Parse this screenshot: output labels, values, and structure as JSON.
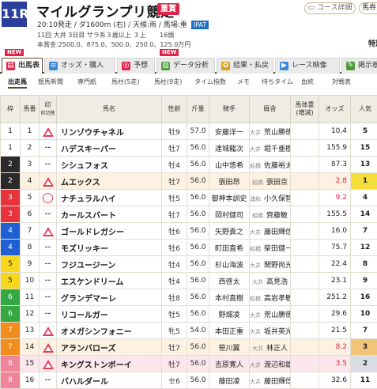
{
  "header": {
    "race_number": "11R",
    "race_name": "マイルグランプリ競走",
    "grade": "重賞",
    "course_btn": "コース詳細",
    "horse_btn": "馬券",
    "detail_line1": "20:10発走 / ダ1600m (右) / 天候:雨",
    "track_cond": "/ 馬場:重",
    "ipat": "IPAT",
    "detail_line2": "11回 大井 3日目 サラ系３歳以上 ３上",
    "head_count": "16頭",
    "prize_line": "本賞金:2500.0、875.0、500.0、250.0、125.0万円",
    "special": "特別"
  },
  "tabs": [
    {
      "label": "出馬表",
      "icon": "table-icon",
      "active": true,
      "is_new": true
    },
    {
      "label": "オッズ・購入",
      "icon": "odds-icon",
      "active": false,
      "is_new": false
    },
    {
      "label": "予想",
      "icon": "target-icon",
      "active": false,
      "is_new": false
    },
    {
      "label": "データ分析",
      "icon": "chart-icon",
      "active": false,
      "is_new": true
    },
    {
      "label": "結果・払戻",
      "icon": "trophy-icon",
      "active": false,
      "is_new": false
    },
    {
      "label": "レース映像",
      "icon": "video-icon",
      "active": false,
      "is_new": false
    },
    {
      "label": "掲示板",
      "icon": "board-icon",
      "active": false,
      "is_new": false
    }
  ],
  "new_badge": "NEW",
  "subtabs": [
    "出走馬",
    "競馬新聞",
    "専門紙",
    "馬柱(5走)",
    "馬柱(9走)",
    "タイム指数",
    "メモ",
    "持ちタイム",
    "血統",
    "対戦表"
  ],
  "table": {
    "headers": {
      "waku": "枠",
      "uma": "馬番",
      "mark": "印",
      "mark_sub": "印切替",
      "name": "馬名",
      "sexage": "性齢",
      "kinryo": "斤量",
      "jockey": "騎手",
      "trainer": "厩舎",
      "weight": "馬体重(増減)",
      "odds": "オッズ",
      "pop": "人気"
    },
    "rows": [
      {
        "waku": "1",
        "uma": "1",
        "mark": "tri",
        "name": "リンゾウチャネル",
        "sexage": "牡9",
        "kinryo": "57.0",
        "jockey": "安藤洋一",
        "loc": "大井",
        "trainer": "荒山勝徳",
        "weight": "",
        "odds": "10.4",
        "pop": "5"
      },
      {
        "waku": "1",
        "uma": "2",
        "mark": "dash",
        "name": "ハデスキーパー",
        "sexage": "牡7",
        "kinryo": "56.0",
        "jockey": "達城龍次",
        "loc": "大井",
        "trainer": "堀千亜樹",
        "weight": "",
        "odds": "155.9",
        "pop": "15"
      },
      {
        "waku": "2",
        "uma": "3",
        "mark": "dash",
        "name": "シシュフォス",
        "sexage": "牡4",
        "kinryo": "56.0",
        "jockey": "山中悠希",
        "loc": "船橋",
        "trainer": "佐藤裕太",
        "weight": "",
        "odds": "87.3",
        "pop": "13"
      },
      {
        "waku": "2",
        "uma": "4",
        "mark": "tri",
        "name": "ムエックス",
        "sexage": "牡7",
        "kinryo": "56.0",
        "jockey": "張田昂",
        "loc": "船橋",
        "trainer": "張田京",
        "weight": "",
        "odds": "2.8",
        "pop": "1"
      },
      {
        "waku": "3",
        "uma": "5",
        "mark": "circle",
        "name": "ナチュラルハイ",
        "sexage": "牡5",
        "kinryo": "56.0",
        "jockey": "御神本訓史",
        "loc": "浦和",
        "trainer": "小久保智",
        "weight": "",
        "odds": "9.2",
        "pop": "4"
      },
      {
        "waku": "3",
        "uma": "6",
        "mark": "dash",
        "name": "カールスバート",
        "sexage": "牡7",
        "kinryo": "56.0",
        "jockey": "岡村健司",
        "loc": "船橋",
        "trainer": "齊藤敏",
        "weight": "",
        "odds": "155.5",
        "pop": "14"
      },
      {
        "waku": "4",
        "uma": "7",
        "mark": "tri",
        "name": "ゴールドレガシー",
        "sexage": "牡6",
        "kinryo": "56.0",
        "jockey": "矢野貴之",
        "loc": "大井",
        "trainer": "藤田輝信",
        "weight": "",
        "odds": "16.0",
        "pop": "7"
      },
      {
        "waku": "4",
        "uma": "8",
        "mark": "dash",
        "name": "モズリッキー",
        "sexage": "牡6",
        "kinryo": "56.0",
        "jockey": "町田直希",
        "loc": "船橋",
        "trainer": "柴田健一",
        "weight": "",
        "odds": "75.7",
        "pop": "12"
      },
      {
        "waku": "5",
        "uma": "9",
        "mark": "dash",
        "name": "フジユージーン",
        "sexage": "牡4",
        "kinryo": "56.0",
        "jockey": "杉山海波",
        "loc": "大井",
        "trainer": "関野尚光",
        "weight": "",
        "odds": "22.4",
        "pop": "8"
      },
      {
        "waku": "5",
        "uma": "10",
        "mark": "dash",
        "name": "エスケンドリーム",
        "sexage": "牡4",
        "kinryo": "56.0",
        "jockey": "西啓太",
        "loc": "大井",
        "trainer": "高見浩",
        "weight": "",
        "odds": "23.1",
        "pop": "9"
      },
      {
        "waku": "6",
        "uma": "11",
        "mark": "dash",
        "name": "グランデマーレ",
        "sexage": "牡8",
        "kinryo": "56.0",
        "jockey": "本村直樹",
        "loc": "船橋",
        "trainer": "高岩孝敏",
        "weight": "",
        "odds": "251.2",
        "pop": "16"
      },
      {
        "waku": "6",
        "uma": "12",
        "mark": "dash",
        "name": "リコールガー",
        "sexage": "牡5",
        "kinryo": "56.0",
        "jockey": "野畑凌",
        "loc": "大井",
        "trainer": "荒山勝徳",
        "weight": "",
        "odds": "29.6",
        "pop": "10"
      },
      {
        "waku": "7",
        "uma": "13",
        "mark": "tri",
        "name": "オメガシンフォニー",
        "sexage": "牝5",
        "kinryo": "54.0",
        "jockey": "本田正重",
        "loc": "大井",
        "trainer": "坂井英光",
        "weight": "",
        "odds": "21.5",
        "pop": "7"
      },
      {
        "waku": "7",
        "uma": "14",
        "mark": "tri",
        "name": "アランバローズ",
        "sexage": "牡7",
        "kinryo": "56.0",
        "jockey": "笹川翼",
        "loc": "大井",
        "trainer": "林正人",
        "weight": "",
        "odds": "8.2",
        "pop": "3"
      },
      {
        "waku": "8",
        "uma": "15",
        "mark": "tri",
        "name": "キングストンボーイ",
        "sexage": "牡7",
        "kinryo": "56.0",
        "jockey": "吉原寛人",
        "loc": "大井",
        "trainer": "渡辺和雄",
        "weight": "",
        "odds": "3.5",
        "pop": "2"
      },
      {
        "waku": "8",
        "uma": "16",
        "mark": "dash",
        "name": "バハルダール",
        "sexage": "セ6",
        "kinryo": "56.0",
        "jockey": "藤田凌",
        "loc": "大井",
        "trainer": "藤田輝信",
        "weight": "",
        "odds": "32.6",
        "pop": "11"
      }
    ]
  },
  "colors": {
    "waku1": "#ffffff",
    "waku2": "#222222",
    "waku3": "#e8323c",
    "waku4": "#1e5fd6",
    "waku5": "#f7d71e",
    "waku6": "#35a844",
    "waku7": "#f08d1c",
    "waku8": "#f0849a",
    "header_blue": "#2b3f9c",
    "accent_red": "#e0234b"
  }
}
